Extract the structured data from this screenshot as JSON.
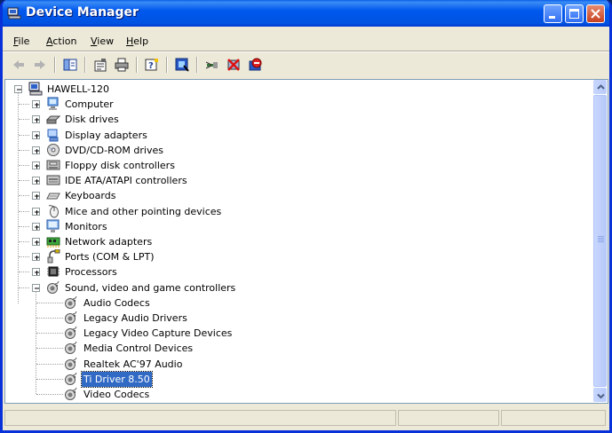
{
  "window": {
    "title": "Device Manager"
  },
  "menu": [
    {
      "id": "file",
      "label": "File",
      "accel": "F",
      "rest": "ile"
    },
    {
      "id": "action",
      "label": "Action",
      "accel": "A",
      "rest": "ction"
    },
    {
      "id": "view",
      "label": "View",
      "accel": "V",
      "rest": "iew"
    },
    {
      "id": "help",
      "label": "Help",
      "accel": "H",
      "rest": "elp"
    }
  ],
  "toolbar": [
    "back-icon",
    "forward-icon",
    "show-hide-console-tree-icon",
    "properties-icon",
    "print-icon",
    "help-icon",
    "scan-hardware-changes-icon",
    "update-driver-icon",
    "uninstall-icon",
    "disable-icon"
  ],
  "tree": {
    "root": "HAWELL-120",
    "categories": [
      {
        "label": "Computer",
        "icon": "computer-icon"
      },
      {
        "label": "Disk drives",
        "icon": "disk-drive-icon"
      },
      {
        "label": "Display adapters",
        "icon": "display-adapter-icon"
      },
      {
        "label": "DVD/CD-ROM drives",
        "icon": "dvd-drive-icon"
      },
      {
        "label": "Floppy disk controllers",
        "icon": "floppy-controller-icon"
      },
      {
        "label": "IDE ATA/ATAPI controllers",
        "icon": "ide-controller-icon"
      },
      {
        "label": "Keyboards",
        "icon": "keyboard-icon"
      },
      {
        "label": "Mice and other pointing devices",
        "icon": "mouse-icon"
      },
      {
        "label": "Monitors",
        "icon": "monitor-icon"
      },
      {
        "label": "Network adapters",
        "icon": "network-adapter-icon"
      },
      {
        "label": "Ports (COM & LPT)",
        "icon": "port-icon"
      },
      {
        "label": "Processors",
        "icon": "processor-icon"
      },
      {
        "label": "Sound, video and game controllers",
        "icon": "sound-icon",
        "expanded": true
      }
    ],
    "sound_children": [
      {
        "label": "Audio Codecs"
      },
      {
        "label": "Legacy Audio Drivers"
      },
      {
        "label": "Legacy Video Capture Devices"
      },
      {
        "label": "Media Control Devices"
      },
      {
        "label": "Realtek AC'97 Audio"
      },
      {
        "label": "Ti Driver 8.50",
        "selected": true
      },
      {
        "label": "Video Codecs"
      }
    ]
  },
  "colors": {
    "titlebar": "#0058ee",
    "selection": "#316ac5",
    "window_face": "#ece9d8"
  }
}
